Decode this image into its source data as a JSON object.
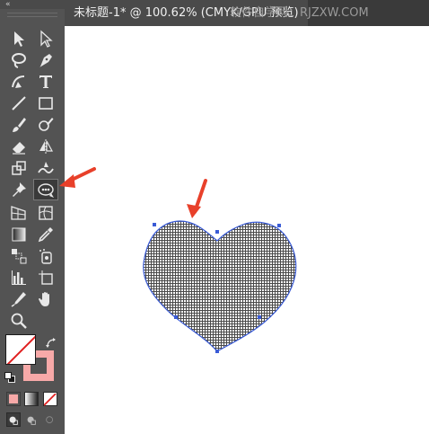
{
  "toolbar": {
    "collapse_glyph": "«",
    "tools": [
      {
        "name": "selection-tool",
        "icon": "arrow-icon"
      },
      {
        "name": "direct-selection-tool",
        "icon": "hollow-arrow-icon"
      },
      {
        "name": "magic-wand-tool",
        "icon": "lasso-icon"
      },
      {
        "name": "pen-tool",
        "icon": "pen-icon"
      },
      {
        "name": "curvature-tool",
        "icon": "curvature-icon"
      },
      {
        "name": "type-tool",
        "icon": "type-icon",
        "label": "T"
      },
      {
        "name": "line-tool",
        "icon": "line-icon"
      },
      {
        "name": "rectangle-tool",
        "icon": "rectangle-icon"
      },
      {
        "name": "paintbrush-tool",
        "icon": "brush-icon"
      },
      {
        "name": "shaper-tool",
        "icon": "shaper-icon"
      },
      {
        "name": "eraser-tool",
        "icon": "eraser-icon"
      },
      {
        "name": "reflect-tool",
        "icon": "reflect-icon"
      },
      {
        "name": "scale-tool",
        "icon": "scale-icon"
      },
      {
        "name": "warp-tool",
        "icon": "warp-icon"
      },
      {
        "name": "puppet-warp-tool",
        "icon": "pin-icon"
      },
      {
        "name": "shape-builder-tool",
        "icon": "shape-builder-icon"
      },
      {
        "name": "perspective-grid-tool",
        "icon": "perspective-icon"
      },
      {
        "name": "mesh-tool",
        "icon": "mesh-icon"
      },
      {
        "name": "gradient-tool",
        "icon": "gradient-icon"
      },
      {
        "name": "eyedropper-tool",
        "icon": "eyedropper-icon"
      },
      {
        "name": "blend-tool",
        "icon": "blend-icon"
      },
      {
        "name": "symbol-sprayer-tool",
        "icon": "symbol-icon"
      },
      {
        "name": "column-graph-tool",
        "icon": "graph-icon"
      },
      {
        "name": "artboard-tool",
        "icon": "artboard-icon"
      },
      {
        "name": "slice-tool",
        "icon": "slice-icon"
      },
      {
        "name": "hand-tool",
        "icon": "hand-icon"
      },
      {
        "name": "zoom-tool",
        "icon": "zoom-icon"
      }
    ],
    "colors": {
      "fill": "#ffffff",
      "stroke": "#f7a9a8",
      "none_slash": "#e02020"
    }
  },
  "document": {
    "tab_title": "未标题-1* @ 100.62% (CMYK/GPU 预览)",
    "watermark": "软件自学网：RJZXW.COM"
  },
  "canvas": {
    "shape": "heart",
    "fill_pattern": "grid-pattern",
    "path_color": "#3a5bd6",
    "arrow_color": "#e8402a"
  }
}
